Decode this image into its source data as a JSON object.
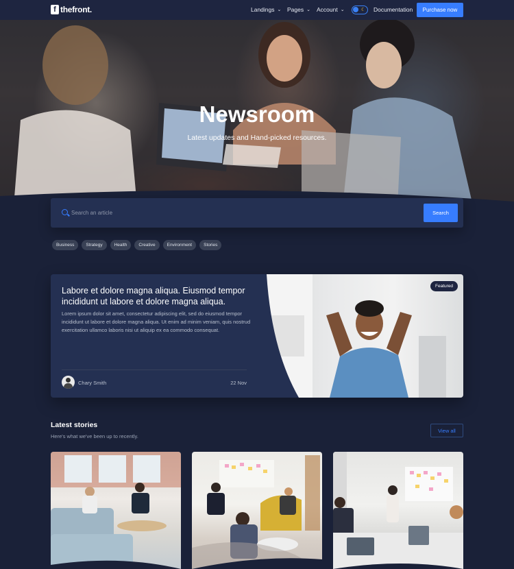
{
  "nav": {
    "logo_mark": "f",
    "logo_text": "thefront.",
    "items": [
      {
        "label": "Landings"
      },
      {
        "label": "Pages"
      },
      {
        "label": "Account"
      }
    ],
    "documentation": "Documentation",
    "purchase": "Purchase now"
  },
  "hero": {
    "title": "Newsroom",
    "subtitle": "Latest updates and Hand-picked resources."
  },
  "search": {
    "placeholder": "Search an article",
    "button": "Search"
  },
  "tags": [
    "Business",
    "Strategy",
    "Health",
    "Creative",
    "Environment",
    "Stories"
  ],
  "featured": {
    "badge": "Featured",
    "title": "Labore et dolore magna aliqua. Eiusmod tempor incididunt ut labore et dolore magna aliqua.",
    "text": "Lorem ipsum dolor sit amet, consectetur adipiscing elit, sed do eiusmod tempor incididunt ut labore et dolore magna aliqua. Ut enim ad minim veniam, quis nostrud exercitation ullamco laboris nisi ut aliquip ex ea commodo consequat.",
    "author": "Chary Smith",
    "date": "22 Nov"
  },
  "latest": {
    "title": "Latest stories",
    "subtitle": "Here's what we've been up to recently.",
    "view_all": "View all"
  },
  "colors": {
    "background": "#1a2138",
    "card": "#243052",
    "accent": "#377dff"
  }
}
